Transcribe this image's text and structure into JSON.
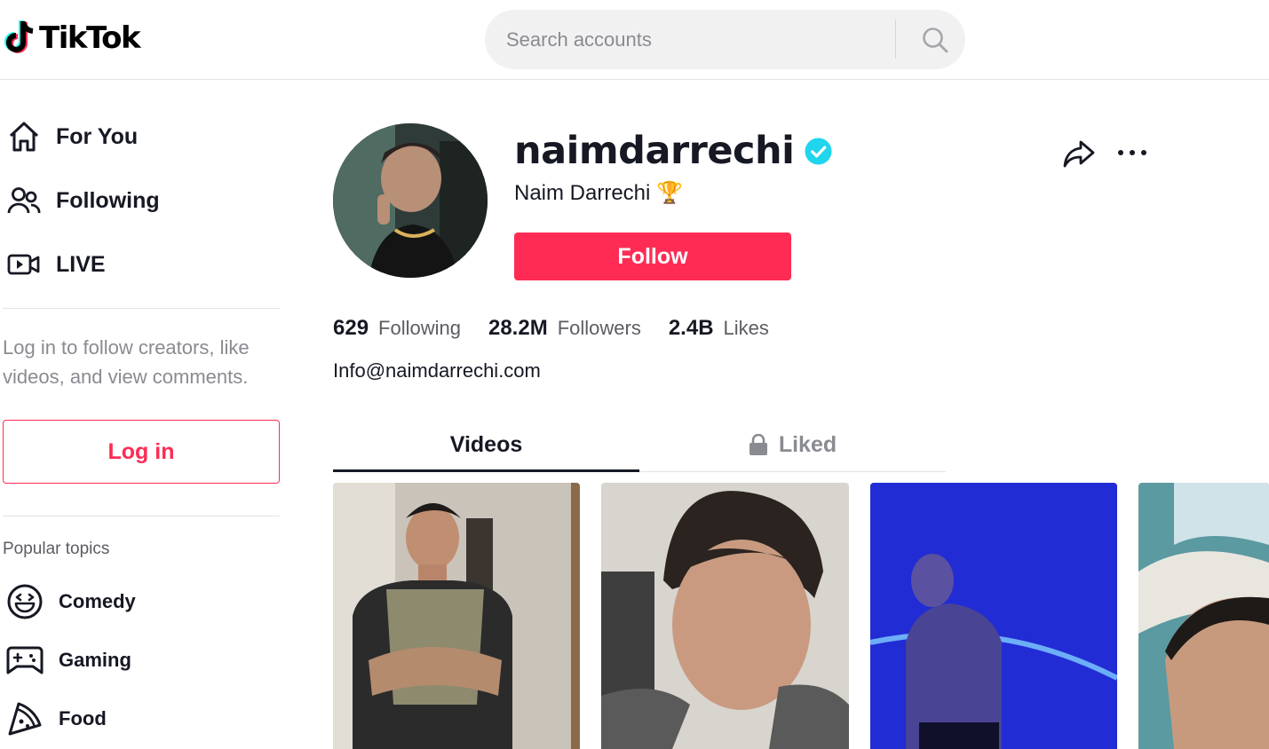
{
  "header": {
    "logo_text": "TikTok",
    "search_placeholder": "Search accounts"
  },
  "sidebar": {
    "nav": [
      {
        "label": "For You",
        "icon": "home-icon"
      },
      {
        "label": "Following",
        "icon": "users-icon"
      },
      {
        "label": "LIVE",
        "icon": "live-camera-icon"
      }
    ],
    "login_prompt": "Log in to follow creators, like videos, and view comments.",
    "login_button": "Log in",
    "topics_title": "Popular topics",
    "topics": [
      {
        "label": "Comedy",
        "icon": "laughing-face-icon"
      },
      {
        "label": "Gaming",
        "icon": "gamepad-icon"
      },
      {
        "label": "Food",
        "icon": "pizza-icon"
      }
    ]
  },
  "profile": {
    "username": "naimdarrechi",
    "display_name": "Naim Darrechi 🏆",
    "follow_button": "Follow",
    "stats": [
      {
        "value": "629",
        "label": "Following"
      },
      {
        "value": "28.2M",
        "label": "Followers"
      },
      {
        "value": "2.4B",
        "label": "Likes"
      }
    ],
    "bio": "Info@naimdarrechi.com"
  },
  "tabs": {
    "videos": "Videos",
    "liked": "Liked"
  },
  "colors": {
    "brand": "#fe2c55",
    "verified": "#20d5ec",
    "text": "#161823",
    "muted": "#8a8b91"
  }
}
